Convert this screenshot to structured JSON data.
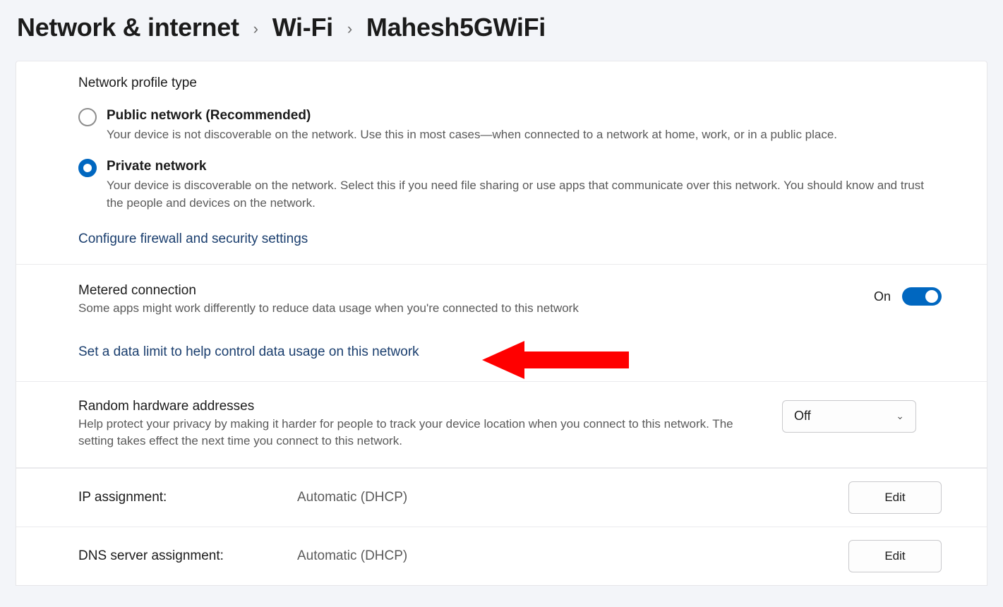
{
  "breadcrumb": {
    "root": "Network & internet",
    "second": "Wi-Fi",
    "current": "Mahesh5GWiFi"
  },
  "network_profile": {
    "heading": "Network profile type",
    "public": {
      "title": "Public network (Recommended)",
      "desc": "Your device is not discoverable on the network. Use this in most cases—when connected to a network at home, work, or in a public place."
    },
    "private": {
      "title": "Private network",
      "desc": "Your device is discoverable on the network. Select this if you need file sharing or use apps that communicate over this network. You should know and trust the people and devices on the network."
    },
    "firewall_link": "Configure firewall and security settings",
    "selected": "private"
  },
  "metered": {
    "heading": "Metered connection",
    "desc": "Some apps might work differently to reduce data usage when you're connected to this network",
    "toggle_state": "On",
    "data_limit_link": "Set a data limit to help control data usage on this network"
  },
  "random_hw": {
    "heading": "Random hardware addresses",
    "desc": "Help protect your privacy by making it harder for people to track your device location when you connect to this network. The setting takes effect the next time you connect to this network.",
    "value": "Off"
  },
  "ip": {
    "label": "IP assignment:",
    "value": "Automatic (DHCP)",
    "edit": "Edit"
  },
  "dns": {
    "label": "DNS server assignment:",
    "value": "Automatic (DHCP)",
    "edit": "Edit"
  }
}
